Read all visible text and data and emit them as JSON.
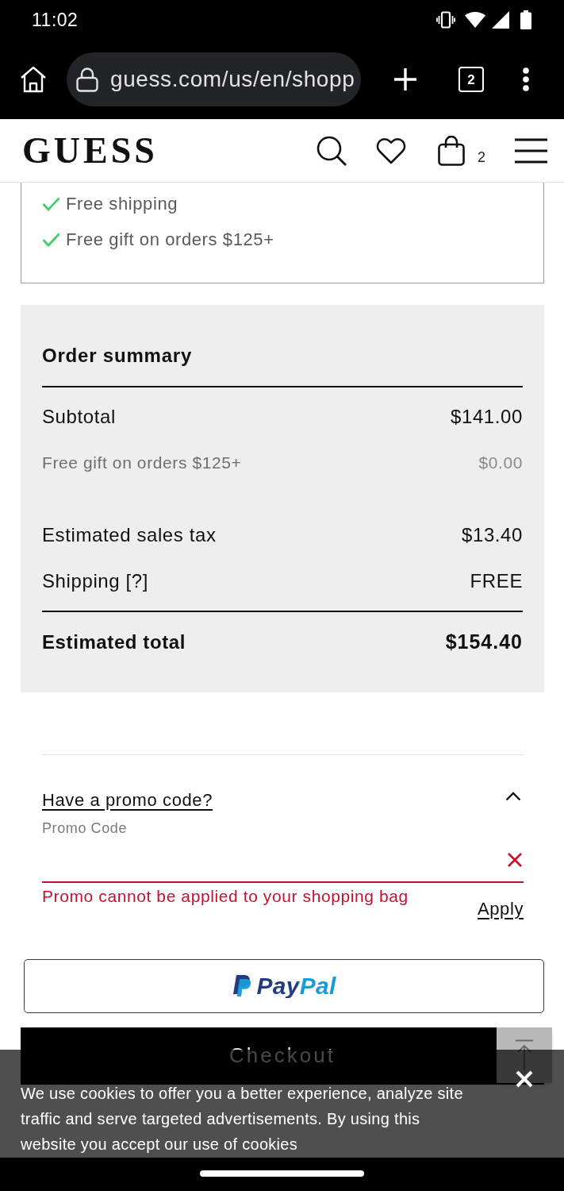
{
  "status_bar": {
    "time": "11:02"
  },
  "browser": {
    "url": "guess.com/us/en/shopp",
    "tab_count": "2"
  },
  "site_header": {
    "logo": "GUESS",
    "cart_count": "2"
  },
  "perks": [
    {
      "label": "Free shipping"
    },
    {
      "label": "Free gift on orders $125+"
    }
  ],
  "order_summary": {
    "title": "Order summary",
    "rows": [
      {
        "kind": "line",
        "label": "Subtotal",
        "value": "$141.00"
      },
      {
        "kind": "note",
        "label": "Free gift on orders $125+",
        "value": "$0.00"
      },
      {
        "kind": "line",
        "label": "Estimated sales tax",
        "value": "$13.40"
      },
      {
        "kind": "line",
        "label": "Shipping [?]",
        "value": "FREE"
      }
    ],
    "total": {
      "label": "Estimated total",
      "value": "$154.40"
    }
  },
  "promo": {
    "toggle": "Have a promo code?",
    "expanded": true,
    "label": "Promo Code",
    "error": "Promo cannot be applied to your shopping bag",
    "apply": "Apply"
  },
  "paypal_button": {
    "logo": "PayPal"
  },
  "checkout_button": {
    "label": "Checkout"
  },
  "cookie_banner": {
    "message": "We use cookies to offer you a better experience, analyze site traffic and serve targeted advertisements. By using this website you accept our use of cookies"
  }
}
